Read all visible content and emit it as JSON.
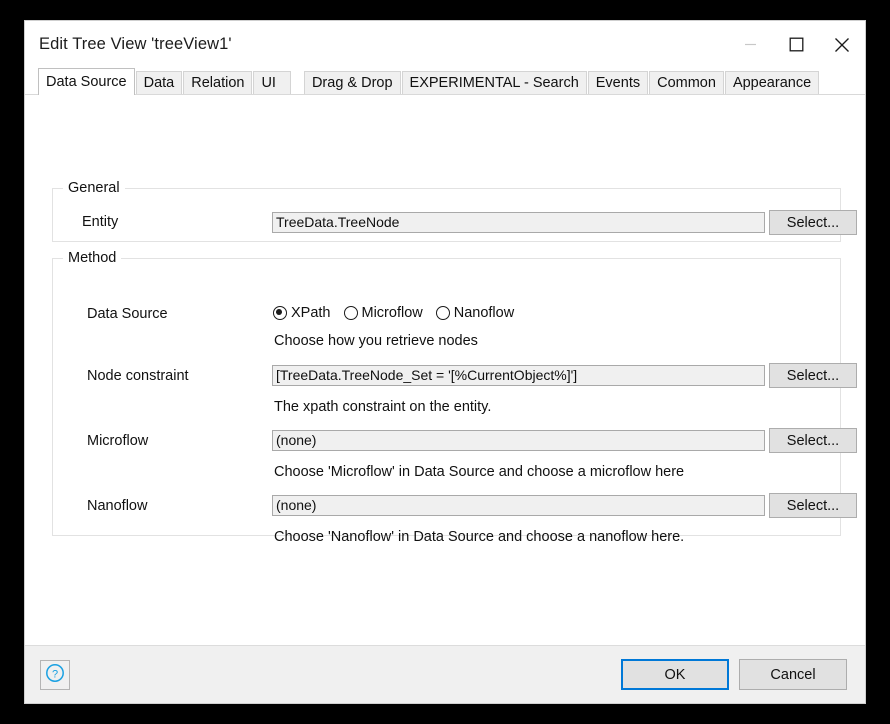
{
  "window": {
    "title": "Edit Tree View 'treeView1'",
    "controls": {
      "minimize": "minimize",
      "maximize": "maximize",
      "close": "close"
    }
  },
  "tabs": [
    {
      "label": "Data Source",
      "active": true
    },
    {
      "label": "Data",
      "active": false
    },
    {
      "label": "Relation",
      "active": false
    },
    {
      "label": "UI",
      "active": false
    },
    {
      "label": "Drag & Drop",
      "active": false
    },
    {
      "label": "EXPERIMENTAL - Search",
      "active": false
    },
    {
      "label": "Events",
      "active": false
    },
    {
      "label": "Common",
      "active": false
    },
    {
      "label": "Appearance",
      "active": false
    }
  ],
  "general": {
    "title": "General",
    "entity": {
      "label": "Entity",
      "value": "TreeData.TreeNode",
      "button": "Select..."
    }
  },
  "method": {
    "title": "Method",
    "data_source": {
      "label": "Data Source",
      "options": [
        "XPath",
        "Microflow",
        "Nanoflow"
      ],
      "selected": "XPath",
      "hint": "Choose how you retrieve nodes"
    },
    "node_constraint": {
      "label": "Node constraint",
      "value": "[TreeData.TreeNode_Set = '[%CurrentObject%]']",
      "button": "Select...",
      "hint": "The xpath constraint on the entity."
    },
    "microflow": {
      "label": "Microflow",
      "value": "(none)",
      "button": "Select...",
      "hint": "Choose 'Microflow' in Data Source and choose a microflow here"
    },
    "nanoflow": {
      "label": "Nanoflow",
      "value": "(none)",
      "button": "Select...",
      "hint": "Choose 'Nanoflow' in Data Source and choose a nanoflow here."
    }
  },
  "footer": {
    "help": "?",
    "ok": "OK",
    "cancel": "Cancel"
  },
  "colors": {
    "focus_accent": "#0078d7",
    "help_icon": "#1ba1e2",
    "field_bg": "#f0f0f0",
    "window_bg": "#ffffff"
  }
}
